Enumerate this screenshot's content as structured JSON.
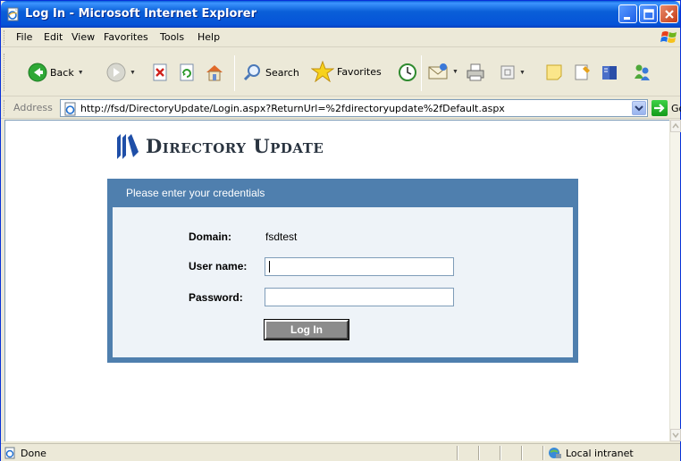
{
  "window": {
    "title": "Log In - Microsoft Internet Explorer"
  },
  "menu": {
    "items": [
      "File",
      "Edit",
      "View",
      "Favorites",
      "Tools",
      "Help"
    ]
  },
  "toolbar": {
    "back_label": "Back",
    "search_label": "Search",
    "favorites_label": "Favorites"
  },
  "address": {
    "label": "Address",
    "url": "http://fsd/DirectoryUpdate/Login.aspx?ReturnUrl=%2fdirectoryupdate%2fDefault.aspx",
    "go_label": "Go"
  },
  "page": {
    "logo_text": "Directory Update",
    "panel_header": "Please enter your credentials",
    "domain_label": "Domain:",
    "domain_value": "fsdtest",
    "username_label": "User name:",
    "username_value": "",
    "password_label": "Password:",
    "password_value": "",
    "login_button": "Log In"
  },
  "status": {
    "text": "Done",
    "zone": "Local intranet"
  },
  "colors": {
    "panel_blue": "#4f7fae",
    "panel_inner": "#eef3f8",
    "xp_title_blue": "#0a5fd8"
  }
}
